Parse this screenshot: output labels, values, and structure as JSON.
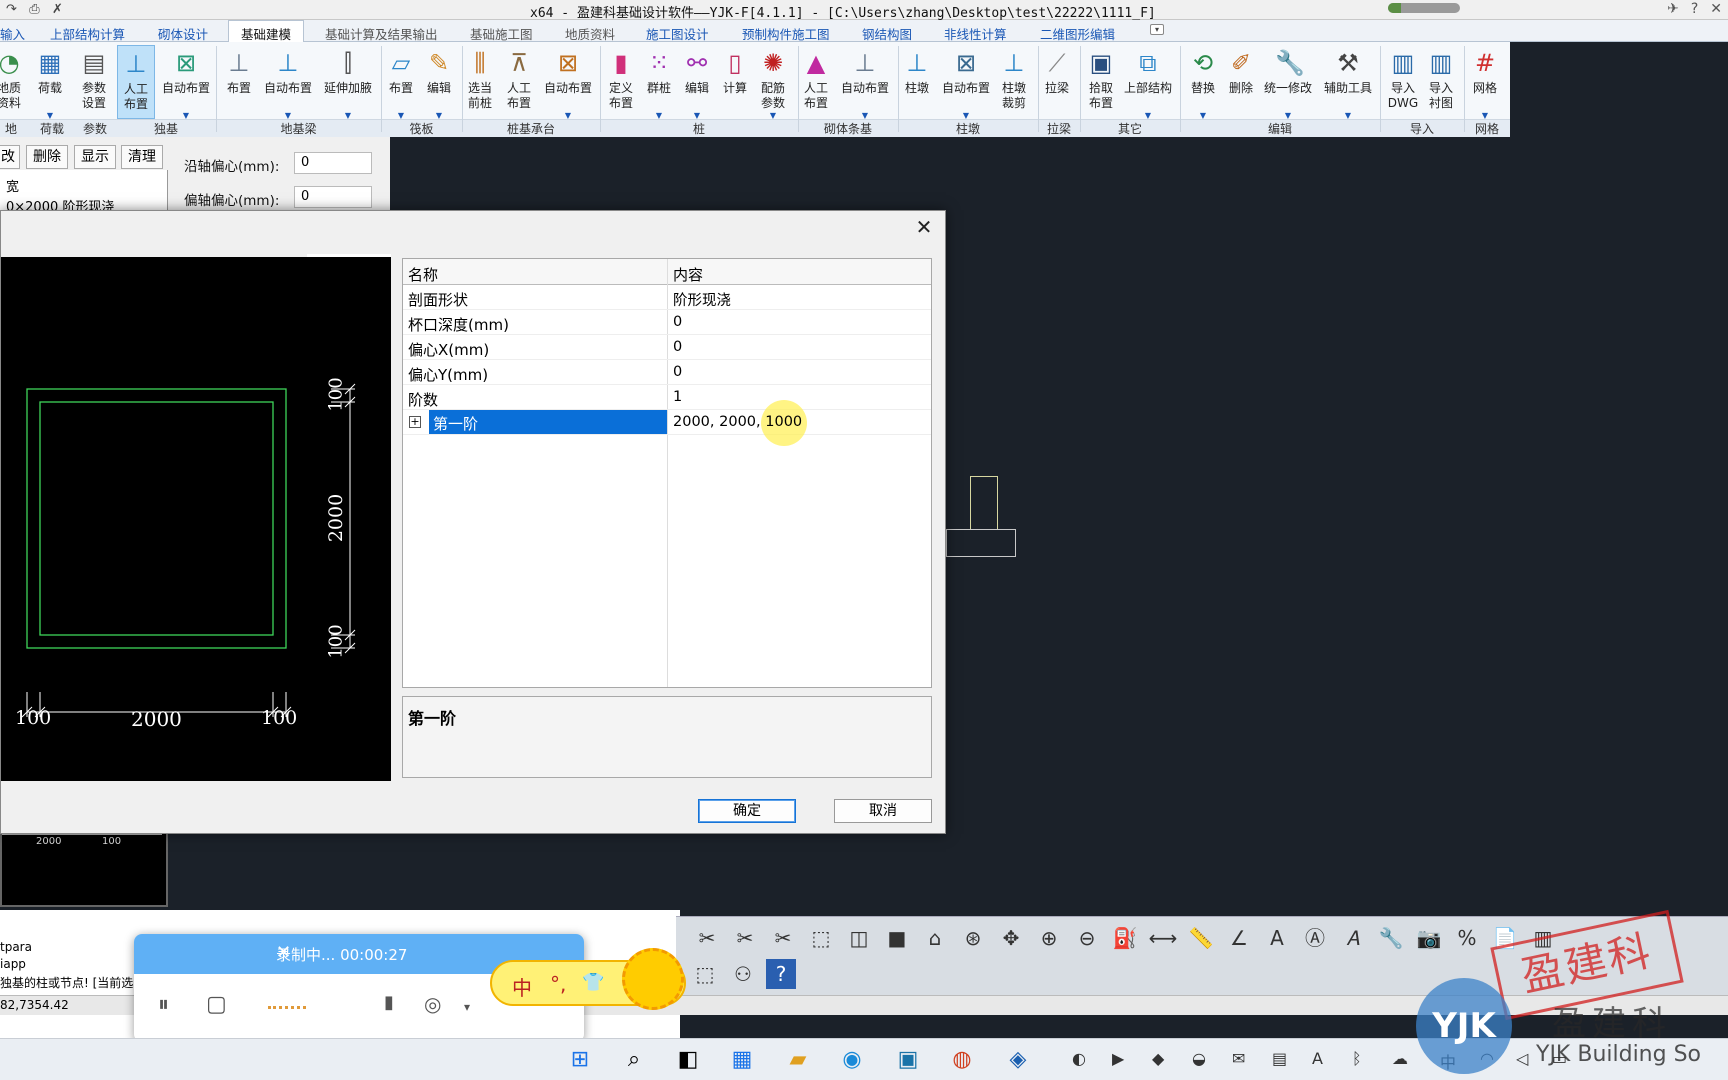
{
  "titlebar": {
    "title": "x64 - 盈建科基础设计软件——YJK-F[4.1.1] - [C:\\Users\\zhang\\Desktop\\test\\22222\\1111_F]",
    "progress_fraction": 0.18
  },
  "menu_tabs": [
    "输入",
    "上部结构计算",
    "砌体设计",
    "基础建模",
    "基础计算及结果输出",
    "基础施工图",
    "地质资料",
    "施工图设计",
    "预制构件施工图",
    "钢结构图",
    "非线性计算",
    "二维图形编辑"
  ],
  "ribbon": {
    "buttons": [
      {
        "label": "地质\n资料",
        "icon": "geology-icon"
      },
      {
        "label": "荷载",
        "icon": "load-icon"
      },
      {
        "label": "参数\n设置",
        "icon": "parameters-icon"
      },
      {
        "label": "人工\n布置",
        "icon": "manual-layout-icon"
      },
      {
        "label": "自动布置",
        "icon": "auto-layout-icon"
      },
      {
        "label": "布置",
        "icon": "beam-layout-icon"
      },
      {
        "label": "自动布置",
        "icon": "auto-layout-icon"
      },
      {
        "label": "延伸加腋",
        "icon": "extend-haunch-icon"
      },
      {
        "label": "布置",
        "icon": "raft-layout-icon"
      },
      {
        "label": "编辑",
        "icon": "edit-icon"
      },
      {
        "label": "选当\n前桩",
        "icon": "select-pile-icon"
      },
      {
        "label": "人工\n布置",
        "icon": "manual-layout-icon"
      },
      {
        "label": "自动布置",
        "icon": "auto-layout-icon"
      },
      {
        "label": "定义\n布置",
        "icon": "define-layout-icon"
      },
      {
        "label": "群桩",
        "icon": "pile-group-icon"
      },
      {
        "label": "编辑",
        "icon": "edit-icon"
      },
      {
        "label": "计算",
        "icon": "calculate-icon"
      },
      {
        "label": "配筋\n参数",
        "icon": "rebar-params-icon"
      },
      {
        "label": "人工\n布置",
        "icon": "manual-layout-icon"
      },
      {
        "label": "自动布置",
        "icon": "auto-layout-icon"
      },
      {
        "label": "柱墩",
        "icon": "column-pier-icon"
      },
      {
        "label": "自动布置",
        "icon": "auto-layout-icon"
      },
      {
        "label": "柱墩\n裁剪",
        "icon": "pier-trim-icon"
      },
      {
        "label": "拉梁",
        "icon": "tie-beam-icon"
      },
      {
        "label": "拾取\n布置",
        "icon": "pick-layout-icon"
      },
      {
        "label": "上部结构",
        "icon": "superstructure-icon"
      },
      {
        "label": "替换",
        "icon": "replace-icon"
      },
      {
        "label": "删除",
        "icon": "delete-icon"
      },
      {
        "label": "统一修改",
        "icon": "batch-edit-icon"
      },
      {
        "label": "辅助工具",
        "icon": "tools-icon"
      },
      {
        "label": "导入\nDWG",
        "icon": "dwg-import-icon"
      },
      {
        "label": "导入\n衬图",
        "icon": "dwg-underlay-icon"
      },
      {
        "label": "网格",
        "icon": "grid-icon"
      }
    ],
    "groups": [
      "地质",
      "荷载",
      "参数",
      "独基",
      "地基梁",
      "筏板",
      "桩基承台",
      "桩",
      "砌体条基",
      "柱墩",
      "拉梁",
      "其它",
      "编辑",
      "导入",
      "网格"
    ]
  },
  "left_panel": {
    "buttons": [
      "改",
      "删除",
      "显示",
      "清理"
    ],
    "along_axis_label": "沿轴偏心(mm):",
    "along_axis_value": "0",
    "off_axis_label": "偏轴偏心(mm):",
    "off_axis_value": "0",
    "col_header": "宽",
    "list_item": "0×2000 阶形现浇"
  },
  "dialog": {
    "preview": {
      "top_dim": "100",
      "mid_dim": "2000",
      "bottom_dim": "100",
      "bl_dim": "100",
      "bm_dim": "2000",
      "br_dim": "100"
    },
    "grid": {
      "col_name": "名称",
      "col_content": "内容",
      "rows": [
        {
          "name": "剖面形状",
          "value": "阶形现浇"
        },
        {
          "name": "杯口深度(mm)",
          "value": "0"
        },
        {
          "name": "偏心X(mm)",
          "value": "0"
        },
        {
          "name": "偏心Y(mm)",
          "value": "0"
        },
        {
          "name": "阶数",
          "value": "1"
        },
        {
          "name": "第一阶",
          "value": "2000, 2000, 1000"
        }
      ]
    },
    "description_title": "第一阶",
    "ok": "确定",
    "cancel": "取消"
  },
  "left_preview": {
    "dim1": "2000",
    "dim2": "100"
  },
  "command": {
    "line1": "tpara",
    "line2": "iapp",
    "line3": "独基的柱或节点! [当前选",
    "coords": "82,7354.42"
  },
  "recorder": {
    "status": "录制中... 00:00:27"
  },
  "ime": {
    "chars": [
      "中",
      "°,",
      "👕"
    ]
  },
  "watermark": {
    "brand": "盈建科",
    "small": "YJK Building So",
    "stamp": "盈建科",
    "logo": "YJK"
  },
  "colors": {
    "canvas": "#1b2129",
    "accent": "#0a6fd8",
    "recorder": "#5fb0f5"
  }
}
